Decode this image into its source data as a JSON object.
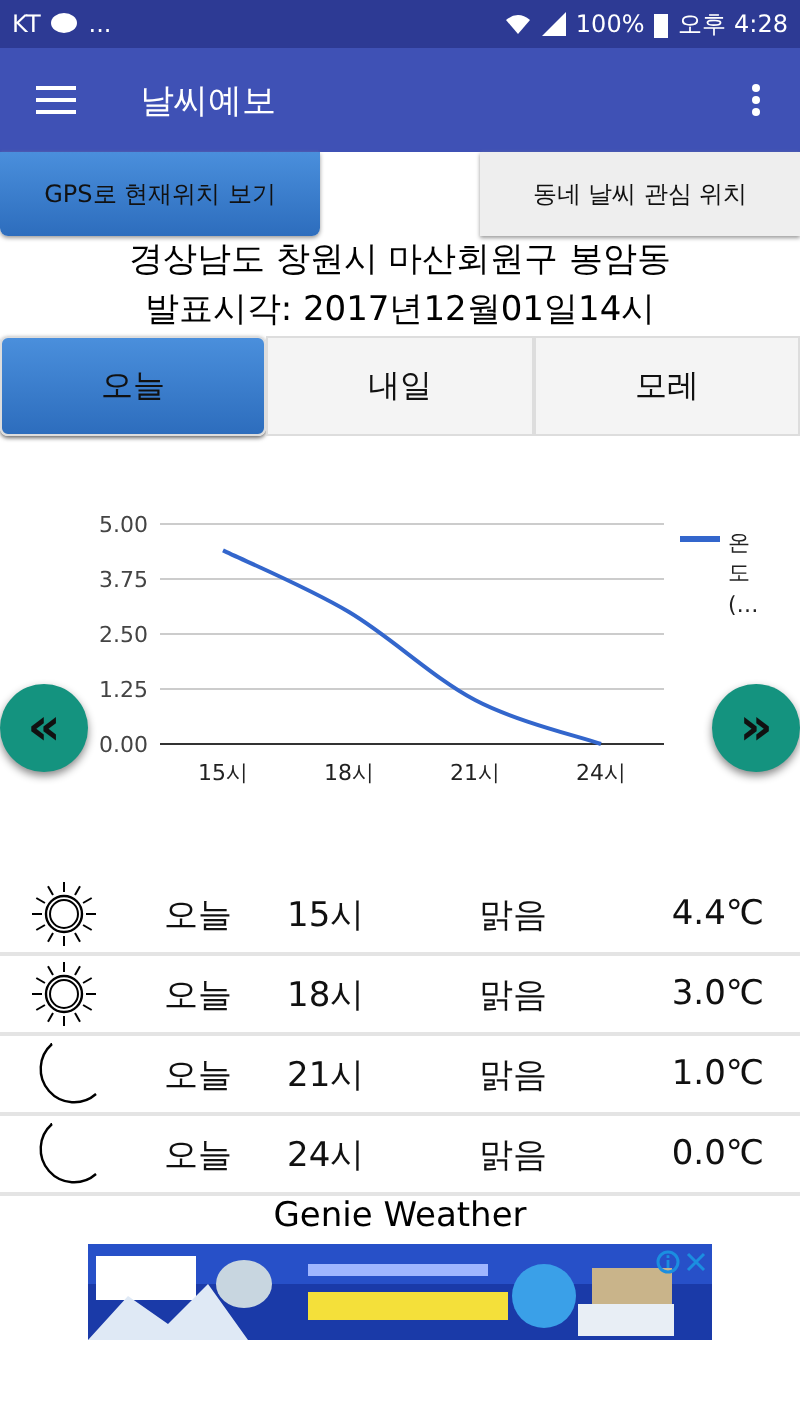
{
  "status_bar": {
    "carrier": "KT",
    "more": "...",
    "battery": "100%",
    "time": "오후 4:28"
  },
  "app_bar": {
    "title": "날씨예보"
  },
  "location_buttons": [
    {
      "label": "GPS로 현재위치 보기",
      "selected": true
    },
    {
      "label": "동네 날씨 관심 위치",
      "selected": false
    }
  ],
  "location": "경상남도 창원시 마산회원구 봉암동",
  "issued": "발표시각: 2017년12월01일14시",
  "tabs": [
    {
      "label": "오늘",
      "selected": true
    },
    {
      "label": "내일",
      "selected": false
    },
    {
      "label": "모레",
      "selected": false
    }
  ],
  "chart": {
    "prev": "«",
    "next": "»",
    "chart_data": {
      "type": "line",
      "categories": [
        "15시",
        "18시",
        "21시",
        "24시"
      ],
      "series": [
        {
          "name": "온도(…",
          "color": "#3366cc",
          "values": [
            4.4,
            3.0,
            1.0,
            0.0
          ]
        }
      ],
      "ylim": [
        0,
        5
      ],
      "grid": true,
      "yticks": [
        {
          "value": 0,
          "label": "0.00"
        },
        {
          "value": 1.25,
          "label": "1.25"
        },
        {
          "value": 2.5,
          "label": "2.50"
        },
        {
          "value": 3.75,
          "label": "3.75"
        },
        {
          "value": 5,
          "label": "5.00"
        }
      ]
    }
  },
  "forecast": [
    {
      "kind": "sun",
      "day": "오늘",
      "hour": "15시",
      "sky": "맑음",
      "temp": "4.4℃"
    },
    {
      "kind": "sun",
      "day": "오늘",
      "hour": "18시",
      "sky": "맑음",
      "temp": "3.0℃"
    },
    {
      "kind": "moon",
      "day": "오늘",
      "hour": "21시",
      "sky": "맑음",
      "temp": "1.0℃"
    },
    {
      "kind": "moon",
      "day": "오늘",
      "hour": "24시",
      "sky": "맑음",
      "temp": "0.0℃"
    }
  ],
  "footer": "Genie Weather"
}
